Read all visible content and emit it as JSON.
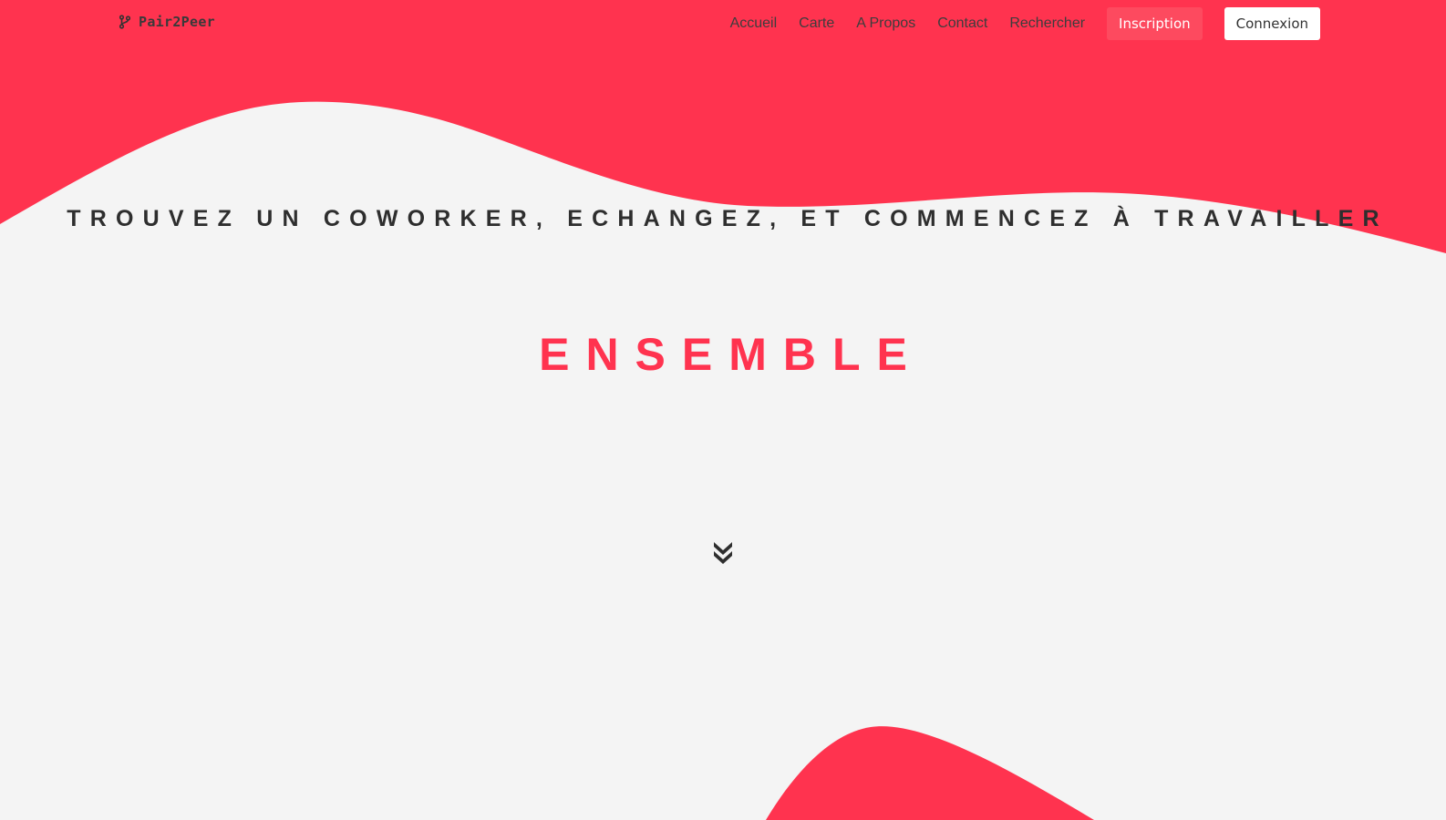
{
  "colors": {
    "accent": "#ff334f",
    "background": "#f4f4f4",
    "text_dark": "#2e2e2e",
    "signup_button": "#fd4a5f",
    "login_button": "#ffffff"
  },
  "navbar": {
    "brand": {
      "icon": "git-branch-icon",
      "label": "Pair2Peer"
    },
    "links": [
      {
        "label": "Accueil"
      },
      {
        "label": "Carte"
      },
      {
        "label": "A Propos"
      },
      {
        "label": "Contact"
      },
      {
        "label": "Rechercher"
      }
    ],
    "signup_label": "Inscription",
    "login_label": "Connexion"
  },
  "hero": {
    "headline": "TROUVEZ UN COWORKER, ECHANGEZ, ET COMMENCEZ À TRAVAILLER",
    "accent_word": "ENSEMBLE",
    "scroll_icon": "double-chevron-down-icon"
  }
}
